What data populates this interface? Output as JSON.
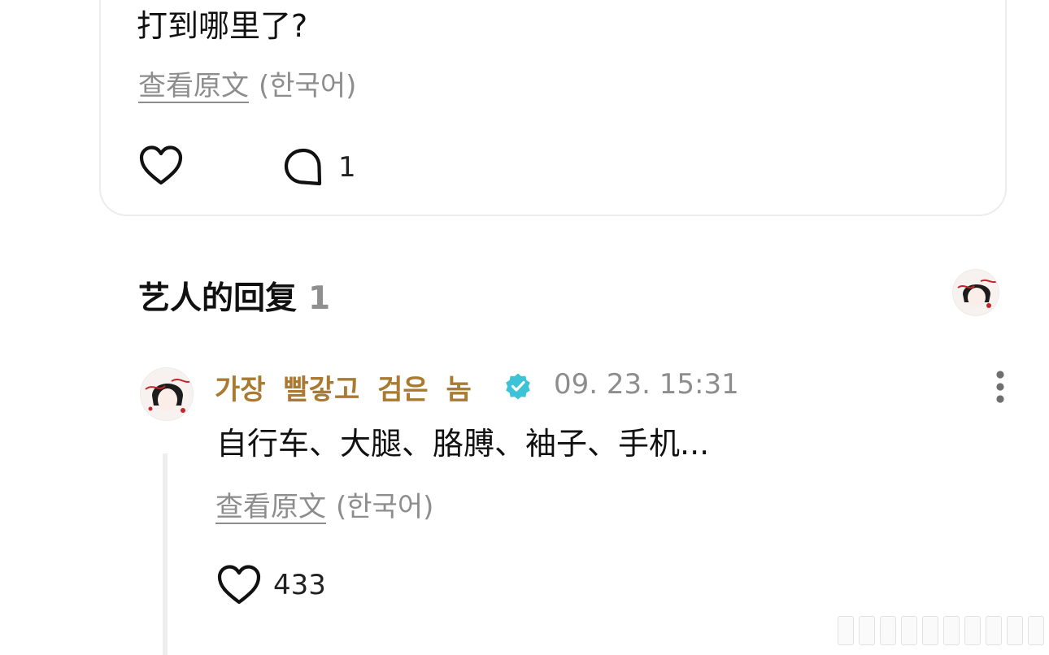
{
  "post": {
    "text": "打到哪里了?",
    "translate_link": "查看原文",
    "translate_lang": "(한국어)",
    "comment_count": "1"
  },
  "artist_replies": {
    "title": "艺人的回复",
    "count": "1"
  },
  "reply": {
    "author": "가장  빨갛고  검은  놈",
    "timestamp": "09. 23. 15:31",
    "text": "自行车、大腿、胳膊、袖子、手机...",
    "translate_link": "查看原文",
    "translate_lang": "(한국어)",
    "like_count": "433"
  },
  "colors": {
    "author_name": "#a97a2f",
    "verified_badge": "#3dc3d8",
    "muted_text": "#8d8d8d",
    "card_border": "#ececec",
    "thread_line": "#eeeeee"
  },
  "icons": {
    "like": "heart-icon",
    "comment": "comment-bubble-icon",
    "verified": "verified-badge-icon",
    "more": "more-vertical-icon"
  }
}
